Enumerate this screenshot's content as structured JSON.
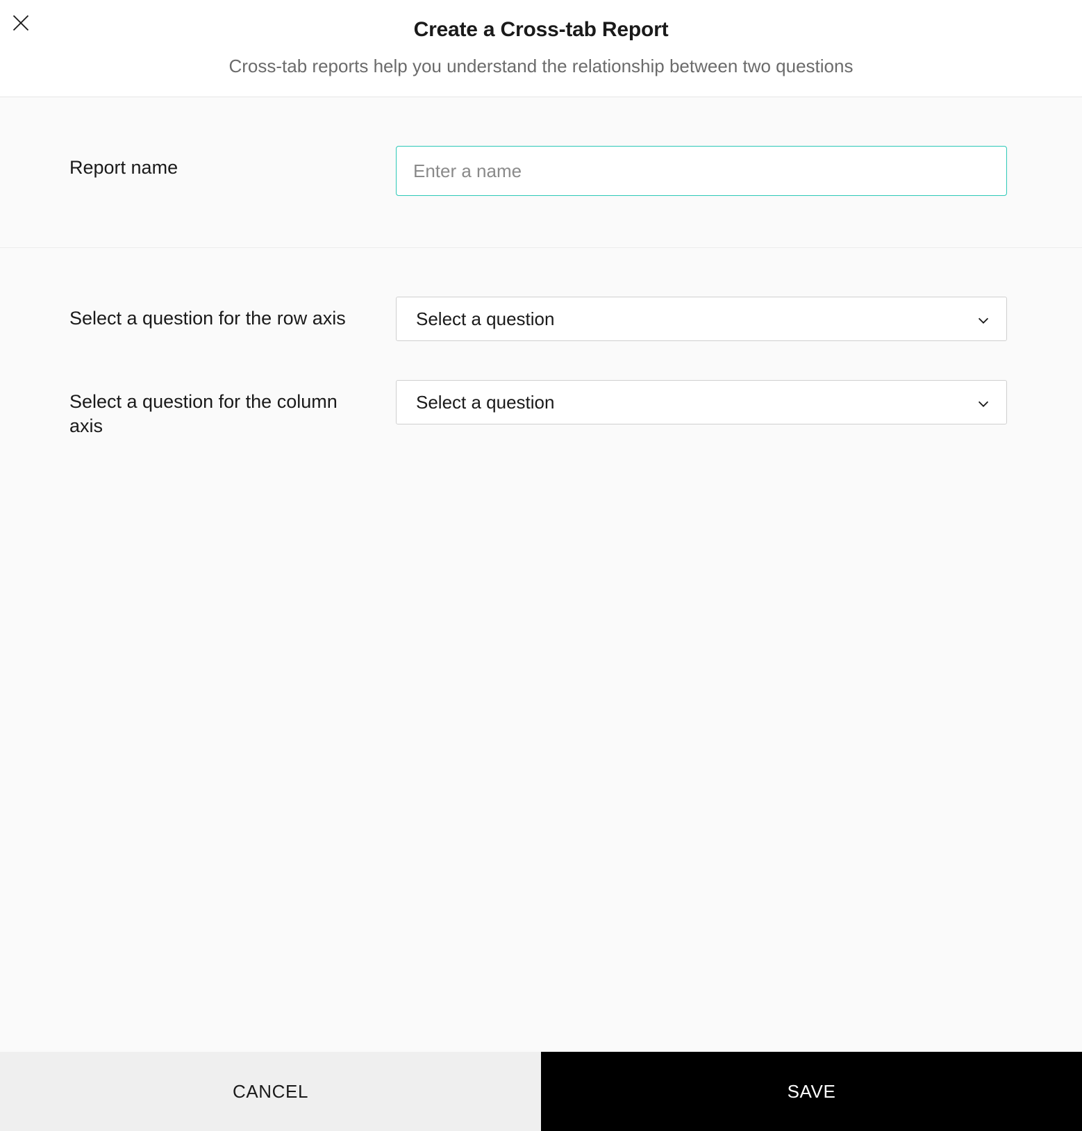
{
  "header": {
    "title": "Create a Cross-tab Report",
    "subtitle": "Cross-tab reports help you understand the relationship between two questions"
  },
  "fields": {
    "report_name": {
      "label": "Report name",
      "placeholder": "Enter a name",
      "value": ""
    },
    "row_axis": {
      "label": "Select a question for the row axis",
      "placeholder": "Select a question"
    },
    "column_axis": {
      "label": "Select a question for the column axis",
      "placeholder": "Select a question"
    }
  },
  "footer": {
    "cancel_label": "CANCEL",
    "save_label": "SAVE"
  }
}
